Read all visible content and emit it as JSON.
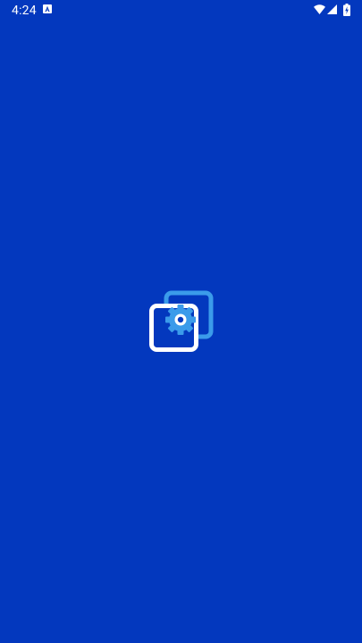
{
  "status_bar": {
    "time": "4:24",
    "icons": [
      "notification-a-icon",
      "wifi-icon",
      "signal-icon",
      "battery-charging-icon"
    ]
  },
  "splash": {
    "logo_icon": "settings-windows-icon",
    "background_color": "#0338BE",
    "logo_accent_color": "#3B9BEA",
    "logo_primary_color": "#FFFFFF"
  }
}
